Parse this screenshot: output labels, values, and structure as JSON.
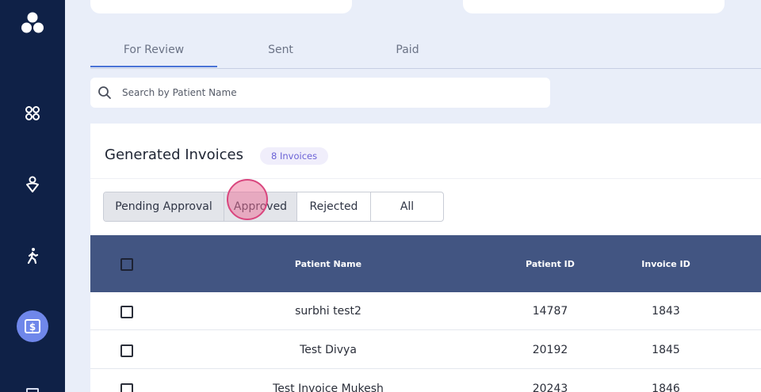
{
  "tabs": [
    {
      "label": "For Review",
      "active": true
    },
    {
      "label": "Sent",
      "active": false
    },
    {
      "label": "Paid",
      "active": false
    }
  ],
  "search": {
    "placeholder": "Search by Patient Name",
    "value": ""
  },
  "panel": {
    "title": "Generated Invoices",
    "badge": "8 Invoices"
  },
  "filters": [
    {
      "label": "Pending Approval",
      "selected": true
    },
    {
      "label": "Approved",
      "selected": true
    },
    {
      "label": "Rejected",
      "selected": false
    },
    {
      "label": "All",
      "selected": false
    }
  ],
  "table": {
    "columns": {
      "patient_name": "Patient Name",
      "patient_id": "Patient ID",
      "invoice_id": "Invoice ID"
    },
    "rows": [
      {
        "patient_name": "surbhi test2",
        "patient_id": "14787",
        "invoice_id": "1843"
      },
      {
        "patient_name": "Test Divya",
        "patient_id": "20192",
        "invoice_id": "1845"
      },
      {
        "patient_name": "Test Invoice  Mukesh",
        "patient_id": "20243",
        "invoice_id": "1846"
      }
    ]
  },
  "sidebar": {
    "icons": [
      "logo-icon",
      "grid-icon",
      "person-heart-icon",
      "walking-icon",
      "billing-icon"
    ],
    "active": "billing-icon"
  },
  "colors": {
    "sidebar_bg": "#0f2147",
    "accent": "#4a73d6",
    "table_header_bg": "#425582",
    "badge_text": "#6b62d6",
    "active_icon_bg": "#6f87ea"
  }
}
